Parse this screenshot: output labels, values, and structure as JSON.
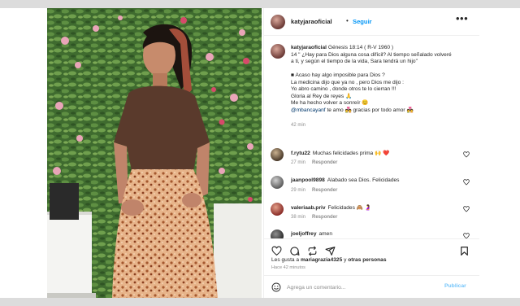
{
  "post": {
    "username": "katyjaraoficial",
    "separator": "•",
    "follow_label": "Seguir",
    "more_icon": "more-horizontal-icon"
  },
  "caption": {
    "username": "katyjaraoficial",
    "line1": " Génesis 18:14 ( R-V 1960 )",
    "line2": "14 \" ¿Hay para Dios alguna cosa difícil? Al tiempo señalado volveré",
    "line3": "a ti, y según el tiempo de la vida, Sara tendrá un hijo\"",
    "line4": "■ Acaso hay algo imposible para Dios ?",
    "line5": "La medicina dijo que ya no , pero Dios me dijo :",
    "line6": "Yo abro camino , donde otros te lo cierran !!!",
    "line7": "Gloria al Rey de reyes 🙏",
    "line8": "Me ha hecho volver a sonreír 😊",
    "mention": "@mbancayanf",
    "line9_rest": " te amo 💑 gracias por todo amor 💑",
    "time": "42 min"
  },
  "comments": [
    {
      "username": "f.rytu22",
      "text": "Muchas felicidades prima 🙌 ❤️",
      "time": "27 min",
      "reply": "Responder"
    },
    {
      "username": "jaanpool9898",
      "text": "Alabado sea Dios. Felicidades",
      "time": "29 min",
      "reply": "Responder"
    },
    {
      "username": "valeriaab.priv",
      "text": "Felicidades 🙈 🤰",
      "time": "38 min",
      "reply": "Responder"
    },
    {
      "username": "joeljoffrey",
      "text": "amen",
      "time": "",
      "reply": ""
    }
  ],
  "likes": {
    "prefix": "Les gusta a ",
    "user": "mariagrazia4325",
    "middle": " y ",
    "others": "otras personas"
  },
  "posted_ago": "Hace 42 minutos",
  "add_comment": {
    "placeholder": "Agrega un comentario...",
    "post_label": "Publicar"
  },
  "colors": {
    "link_blue": "#0095f6",
    "mention_blue": "#00376b",
    "muted_gray": "#8e8e8e",
    "text_dark": "#262626"
  }
}
